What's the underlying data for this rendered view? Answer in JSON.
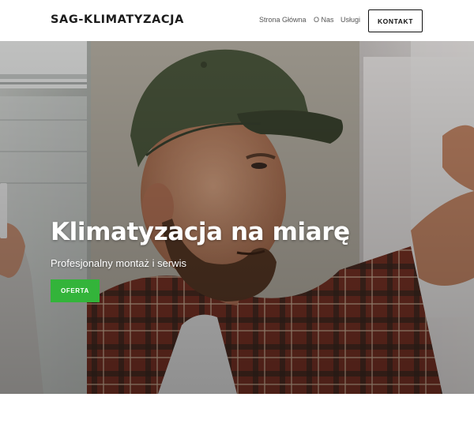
{
  "header": {
    "brand": "SAG-KLIMATYZACJA",
    "nav": [
      "Strona Główna",
      "O Nas",
      "Usługi"
    ],
    "cta": "KONTAKT"
  },
  "hero": {
    "title": "Klimatyzacja na miarę",
    "subtitle": "Profesjonalny montaż i serwis",
    "button": "OFERTA",
    "image_subject": "technician-in-cap-installing-air-conditioner"
  },
  "colors": {
    "accent_green": "#33b43a",
    "text_dark": "#1c1c1c",
    "cap_olive": "#4e5a3f",
    "shirt_plaid": "#8a3b2c"
  }
}
